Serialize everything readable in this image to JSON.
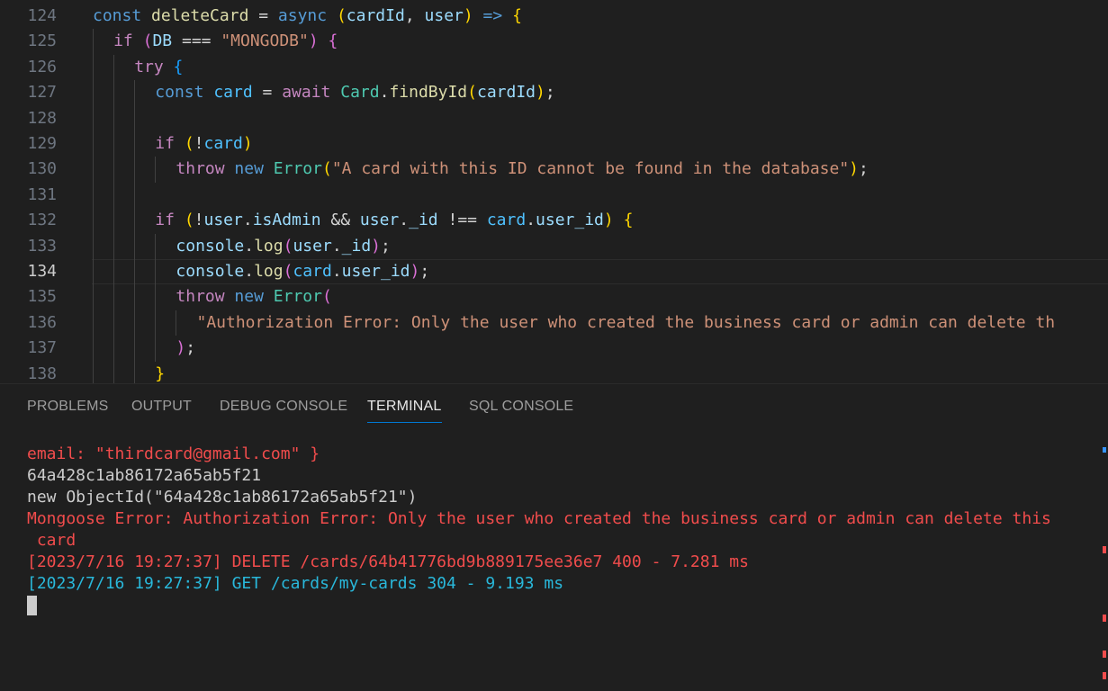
{
  "editor": {
    "lines": [
      {
        "number": "124",
        "indent": 0,
        "tokens": [
          [
            "const ",
            "kw"
          ],
          [
            "deleteCard",
            "fn"
          ],
          [
            " = ",
            "op"
          ],
          [
            "async ",
            "kw"
          ],
          [
            "(",
            "b1"
          ],
          [
            "cardId",
            "var"
          ],
          [
            ", ",
            "op"
          ],
          [
            "user",
            "var"
          ],
          [
            ")",
            "b1"
          ],
          [
            " => ",
            "kw"
          ],
          [
            "{",
            "b1"
          ]
        ]
      },
      {
        "number": "125",
        "indent": 1,
        "tokens": [
          [
            "if ",
            "ctl"
          ],
          [
            "(",
            "b2"
          ],
          [
            "DB",
            "var"
          ],
          [
            " === ",
            "op"
          ],
          [
            "\"MONGODB\"",
            "str"
          ],
          [
            ")",
            "b2"
          ],
          [
            " {",
            "b2"
          ]
        ]
      },
      {
        "number": "126",
        "indent": 2,
        "tokens": [
          [
            "try ",
            "ctl"
          ],
          [
            "{",
            "b3"
          ]
        ]
      },
      {
        "number": "127",
        "indent": 3,
        "tokens": [
          [
            "const ",
            "kw"
          ],
          [
            "card",
            "cst"
          ],
          [
            " = ",
            "op"
          ],
          [
            "await ",
            "ctl"
          ],
          [
            "Card",
            "cls"
          ],
          [
            ".",
            "op"
          ],
          [
            "findById",
            "fn"
          ],
          [
            "(",
            "b1"
          ],
          [
            "cardId",
            "var"
          ],
          [
            ")",
            "b1"
          ],
          [
            ";",
            "op"
          ]
        ]
      },
      {
        "number": "128",
        "indent": 3,
        "tokens": []
      },
      {
        "number": "129",
        "indent": 3,
        "tokens": [
          [
            "if ",
            "ctl"
          ],
          [
            "(",
            "b1"
          ],
          [
            "!",
            "op"
          ],
          [
            "card",
            "cst"
          ],
          [
            ")",
            "b1"
          ]
        ]
      },
      {
        "number": "130",
        "indent": 4,
        "tokens": [
          [
            "throw ",
            "ctl"
          ],
          [
            "new ",
            "kw"
          ],
          [
            "Error",
            "cls"
          ],
          [
            "(",
            "b1"
          ],
          [
            "\"A card with this ID cannot be found in the database\"",
            "str"
          ],
          [
            ")",
            "b1"
          ],
          [
            ";",
            "op"
          ]
        ]
      },
      {
        "number": "131",
        "indent": 3,
        "tokens": []
      },
      {
        "number": "132",
        "indent": 3,
        "tokens": [
          [
            "if ",
            "ctl"
          ],
          [
            "(",
            "b1"
          ],
          [
            "!",
            "op"
          ],
          [
            "user",
            "var"
          ],
          [
            ".",
            "op"
          ],
          [
            "isAdmin",
            "var"
          ],
          [
            " && ",
            "op"
          ],
          [
            "user",
            "var"
          ],
          [
            ".",
            "op"
          ],
          [
            "_id",
            "var"
          ],
          [
            " !== ",
            "op"
          ],
          [
            "card",
            "cst"
          ],
          [
            ".",
            "op"
          ],
          [
            "user_id",
            "var"
          ],
          [
            ")",
            "b1"
          ],
          [
            " {",
            "b1"
          ]
        ]
      },
      {
        "number": "133",
        "indent": 4,
        "tokens": [
          [
            "console",
            "var"
          ],
          [
            ".",
            "op"
          ],
          [
            "log",
            "fn"
          ],
          [
            "(",
            "b2"
          ],
          [
            "user",
            "var"
          ],
          [
            ".",
            "op"
          ],
          [
            "_id",
            "var"
          ],
          [
            ")",
            "b2"
          ],
          [
            ";",
            "op"
          ]
        ]
      },
      {
        "number": "134",
        "indent": 4,
        "current": true,
        "tokens": [
          [
            "console",
            "var"
          ],
          [
            ".",
            "op"
          ],
          [
            "log",
            "fn"
          ],
          [
            "(",
            "b2"
          ],
          [
            "card",
            "cst"
          ],
          [
            ".",
            "op"
          ],
          [
            "user_id",
            "var"
          ],
          [
            ")",
            "b2"
          ],
          [
            ";",
            "op"
          ]
        ]
      },
      {
        "number": "135",
        "indent": 4,
        "tokens": [
          [
            "throw ",
            "ctl"
          ],
          [
            "new ",
            "kw"
          ],
          [
            "Error",
            "cls"
          ],
          [
            "(",
            "b2"
          ]
        ]
      },
      {
        "number": "136",
        "indent": 5,
        "tokens": [
          [
            "\"Authorization Error: Only the user who created the business card or admin can delete th",
            "str"
          ]
        ]
      },
      {
        "number": "137",
        "indent": 4,
        "tokens": [
          [
            ")",
            "b2"
          ],
          [
            ";",
            "op"
          ]
        ]
      },
      {
        "number": "138",
        "indent": 3,
        "tokens": [
          [
            "}",
            "b1"
          ]
        ]
      }
    ]
  },
  "panel": {
    "tabs": [
      {
        "label": "PROBLEMS",
        "active": false
      },
      {
        "label": "OUTPUT",
        "active": false
      },
      {
        "label": "DEBUG CONSOLE",
        "active": false
      },
      {
        "label": "TERMINAL",
        "active": true
      },
      {
        "label": "SQL CONSOLE",
        "active": false
      }
    ]
  },
  "terminal": {
    "lines": [
      {
        "text": "email: \"thirdcard@gmail.com\" }",
        "color": "red"
      },
      {
        "text": "64a428c1ab86172a65ab5f21",
        "color": "white"
      },
      {
        "text": "new ObjectId(\"64a428c1ab86172a65ab5f21\")",
        "color": "white"
      },
      {
        "text": "Mongoose Error: Authorization Error: Only the user who created the business card or admin can delete this",
        "color": "red"
      },
      {
        "text": " card",
        "color": "red"
      },
      {
        "text": "[2023/7/16 19:27:37] DELETE /cards/64b41776bd9b889175ee36e7 400 - 7.281 ms",
        "color": "red"
      },
      {
        "text": "[2023/7/16 19:27:37] GET /cards/my-cards 304 - 9.193 ms",
        "color": "cyan"
      }
    ]
  },
  "colors": {
    "background": "#1f1f1f",
    "error_red": "#f14c4c",
    "info_cyan": "#29b8db",
    "tab_active_underline": "#0078d4"
  }
}
